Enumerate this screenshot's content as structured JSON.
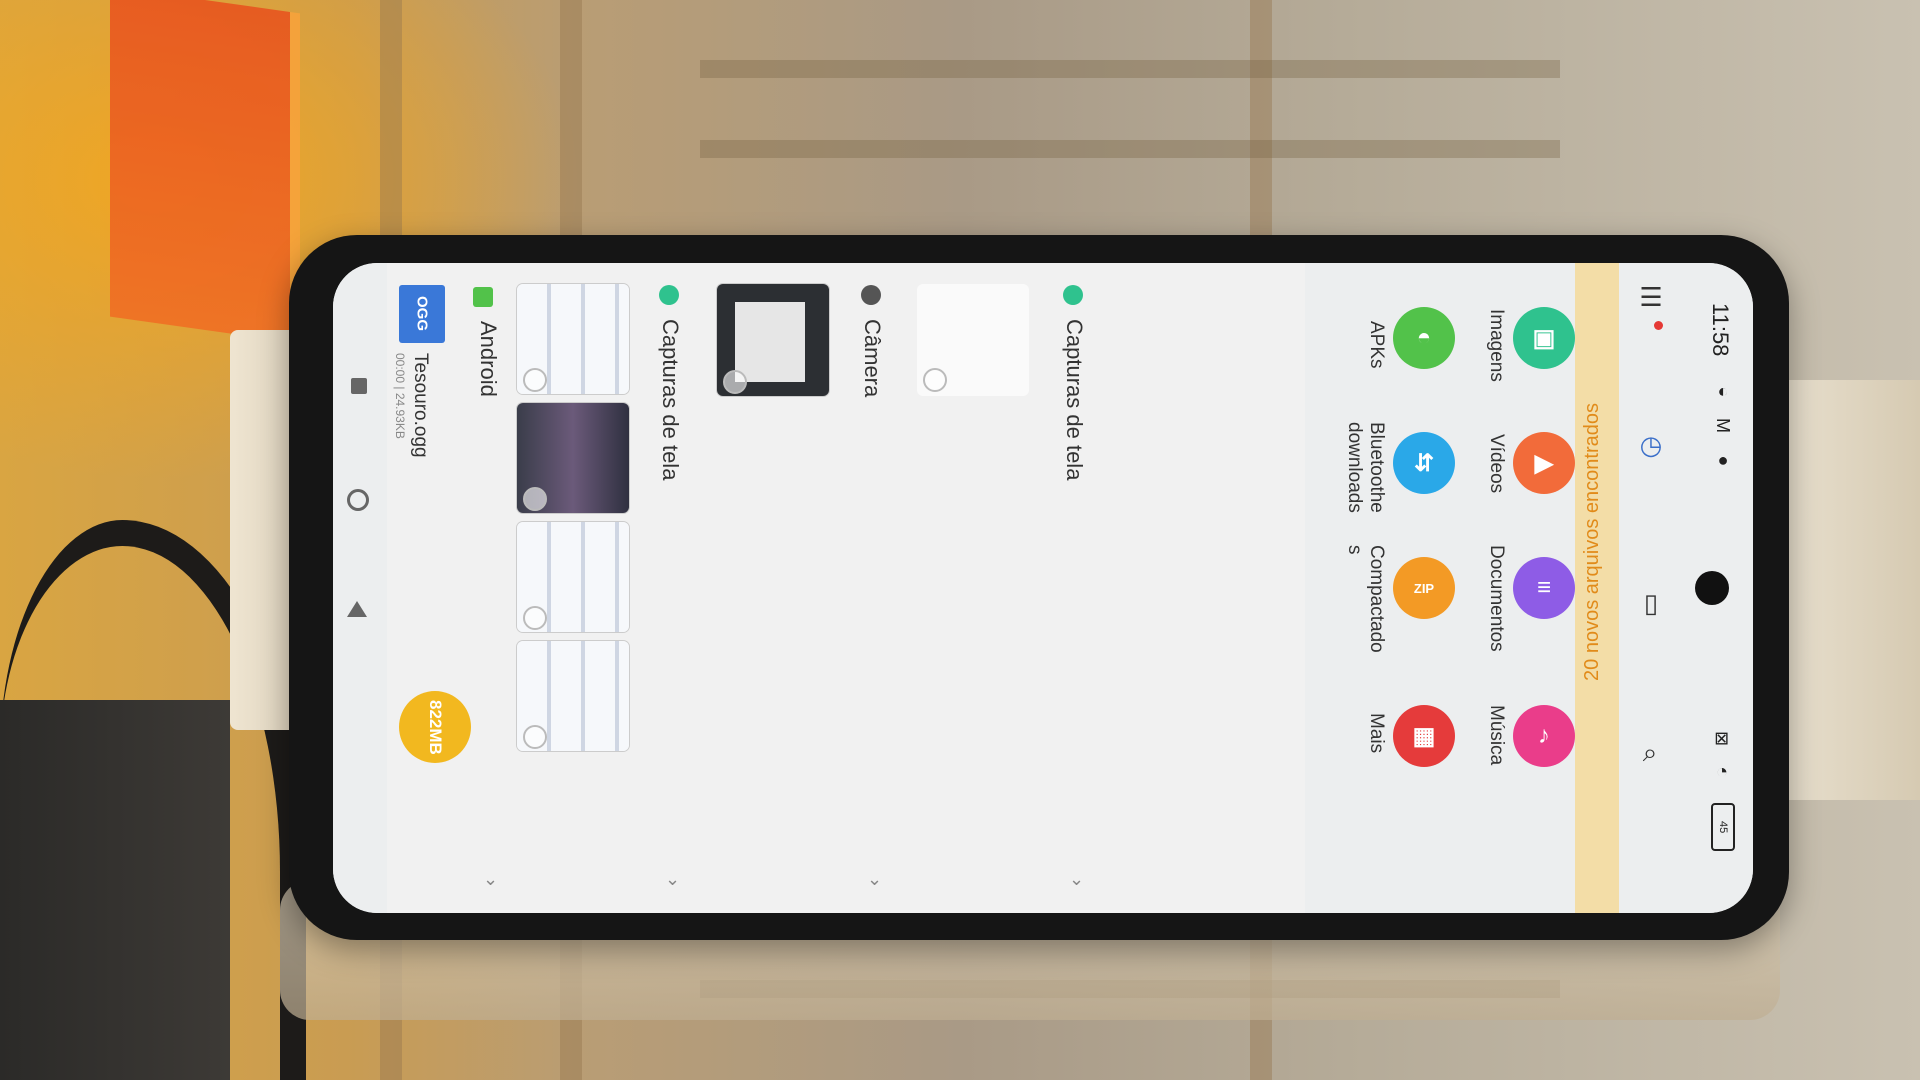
{
  "status_bar": {
    "time": "11:58",
    "indicators": "◐ M ●",
    "battery": "45"
  },
  "toolbar": {
    "menu_icon": "menu-icon",
    "recent_icon": "clock-icon",
    "tablet_icon": "tablet-icon",
    "search_icon": "search-icon"
  },
  "banner": {
    "text": "20 novos arquivos encontrados"
  },
  "categories": [
    {
      "label": "Imagens",
      "icon": "image-icon",
      "color": "#2fc28e"
    },
    {
      "label": "Vídeos",
      "icon": "video-icon",
      "color": "#f26b3a"
    },
    {
      "label": "Documentos",
      "icon": "document-icon",
      "color": "#8e5ce6"
    },
    {
      "label": "Música",
      "icon": "music-icon",
      "color": "#ea3d8a"
    },
    {
      "label": "APKs",
      "icon": "android-icon",
      "color": "#52c24a"
    },
    {
      "label": "Bluetoothe\ndownloads",
      "icon": "bluetooth-icon",
      "color": "#2aa8e8"
    },
    {
      "label": "Compactado\ns",
      "icon": "zip-icon",
      "color": "#f39a25",
      "glyph": "ZIP"
    },
    {
      "label": "Mais",
      "icon": "grid-icon",
      "color": "#e53b3b"
    }
  ],
  "recents": {
    "sections": [
      {
        "title": "Capturas de tela",
        "dot_color": "#2fc28e"
      },
      {
        "title": "Câmera",
        "dot_color": "#555555"
      },
      {
        "title": "Capturas de tela",
        "dot_color": "#2fc28e"
      },
      {
        "title": "Android",
        "dot_color": "#52c24a"
      }
    ],
    "file": {
      "name": "Tesouro.ogg",
      "meta": "00:00 | 24.93KB",
      "icon_text": "OGG"
    },
    "storage": "822MB"
  }
}
